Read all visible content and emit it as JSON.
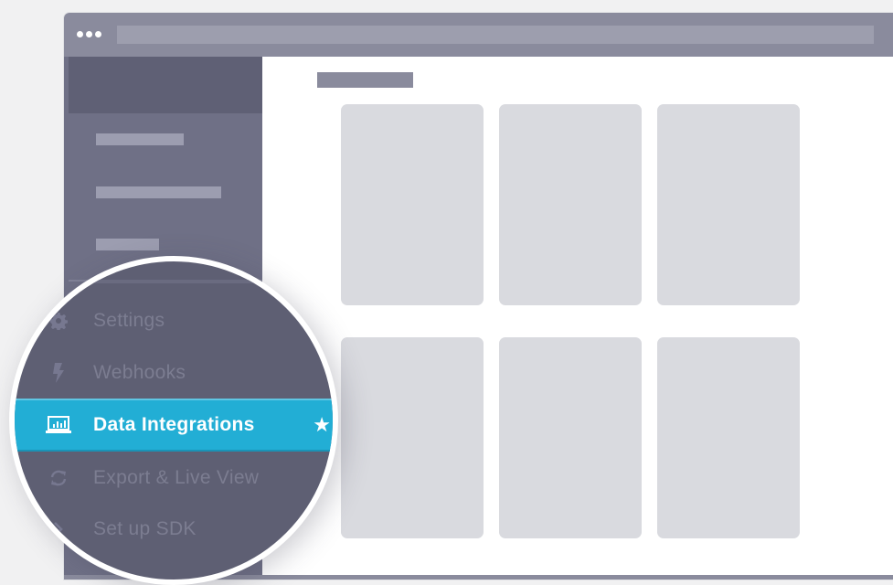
{
  "colors": {
    "accent": "#22aed5",
    "sidebar": "#6f7086",
    "sidebar_dark": "#5e5f73",
    "titlebar": "#8a8b9d",
    "card": "#d9dadf"
  },
  "menu": {
    "items": [
      {
        "label": "Settings",
        "icon": "gear-icon",
        "active": false
      },
      {
        "label": "Webhooks",
        "icon": "lightning-bolt-icon",
        "active": false
      },
      {
        "label": "Data Integrations",
        "icon": "chart-monitor-icon",
        "active": true,
        "badge": "★"
      },
      {
        "label": "Export & Live View",
        "icon": "refresh-arrows-icon",
        "active": false
      },
      {
        "label": "Set up SDK",
        "icon": "chevron-right-icon",
        "active": false
      }
    ]
  }
}
